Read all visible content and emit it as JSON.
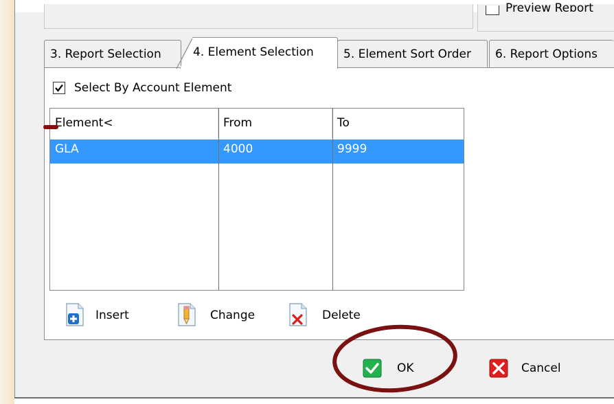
{
  "top": {
    "preview_label": "Preview Report"
  },
  "tabs": [
    {
      "label": "3. Report Selection"
    },
    {
      "label": "4. Element Selection"
    },
    {
      "label": "5. Element Sort Order"
    },
    {
      "label": "6. Report Options"
    }
  ],
  "options": {
    "select_by_account_element": {
      "label": "Select By Account Element",
      "checked": true
    }
  },
  "grid": {
    "columns": [
      "Element<",
      "From",
      "To"
    ],
    "rows": [
      {
        "element": "GLA",
        "from": "4000",
        "to": "9999",
        "selected": true
      }
    ]
  },
  "actions": {
    "insert": "Insert",
    "change": "Change",
    "delete": "Delete"
  },
  "dialog_buttons": {
    "ok": "OK",
    "cancel": "Cancel"
  },
  "colors": {
    "selection": "#3399ff",
    "annotation": "#8b0e0e",
    "ok_icon": "#22b14c",
    "cancel_icon": "#e02020"
  }
}
